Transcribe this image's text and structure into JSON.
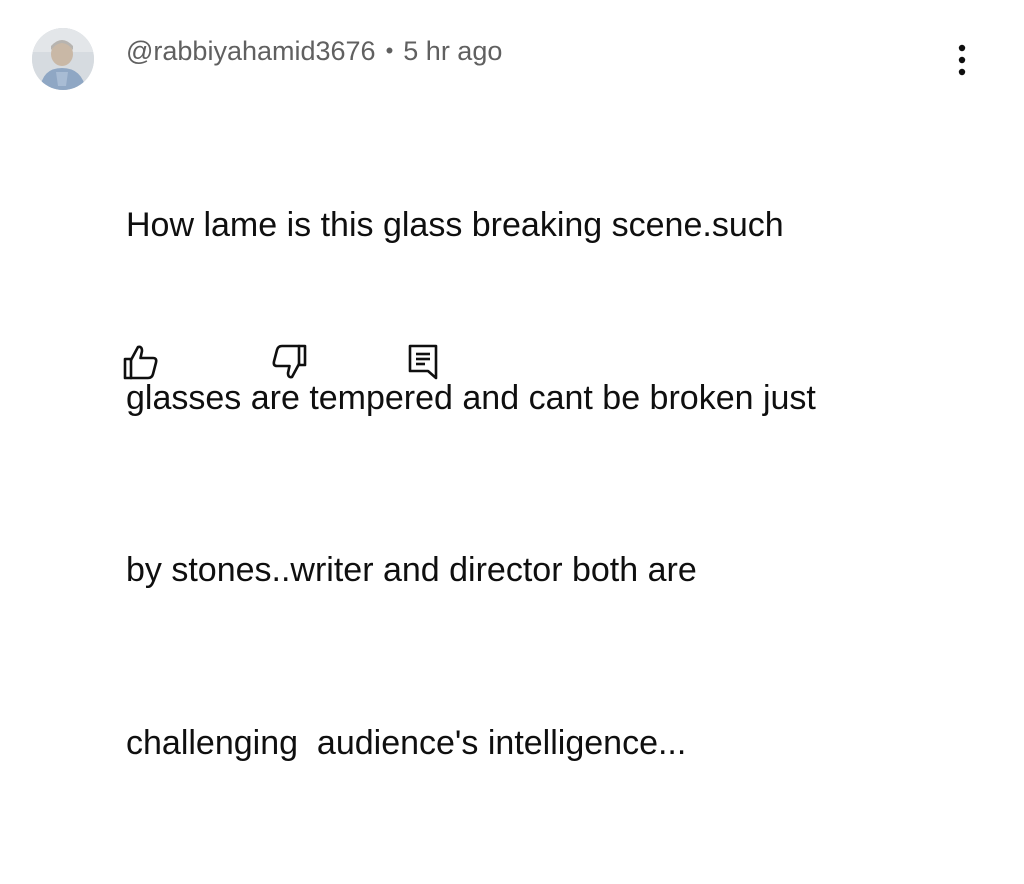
{
  "comment": {
    "author_handle": "@rabbiyahamid3676",
    "separator": "•",
    "timestamp": "5 hr ago",
    "text_lines": [
      "How lame is this glass breaking scene.such",
      "glasses are tempered and cant be broken just",
      "by stones..writer and director both are",
      "challenging  audience's intelligence..."
    ]
  },
  "icons": {
    "more": "more-vertical-icon",
    "like": "thumbs-up-icon",
    "dislike": "thumbs-down-icon",
    "reply": "reply-comment-icon"
  },
  "colors": {
    "text_primary": "#0f0f0f",
    "text_secondary": "#606060",
    "background": "#ffffff"
  }
}
